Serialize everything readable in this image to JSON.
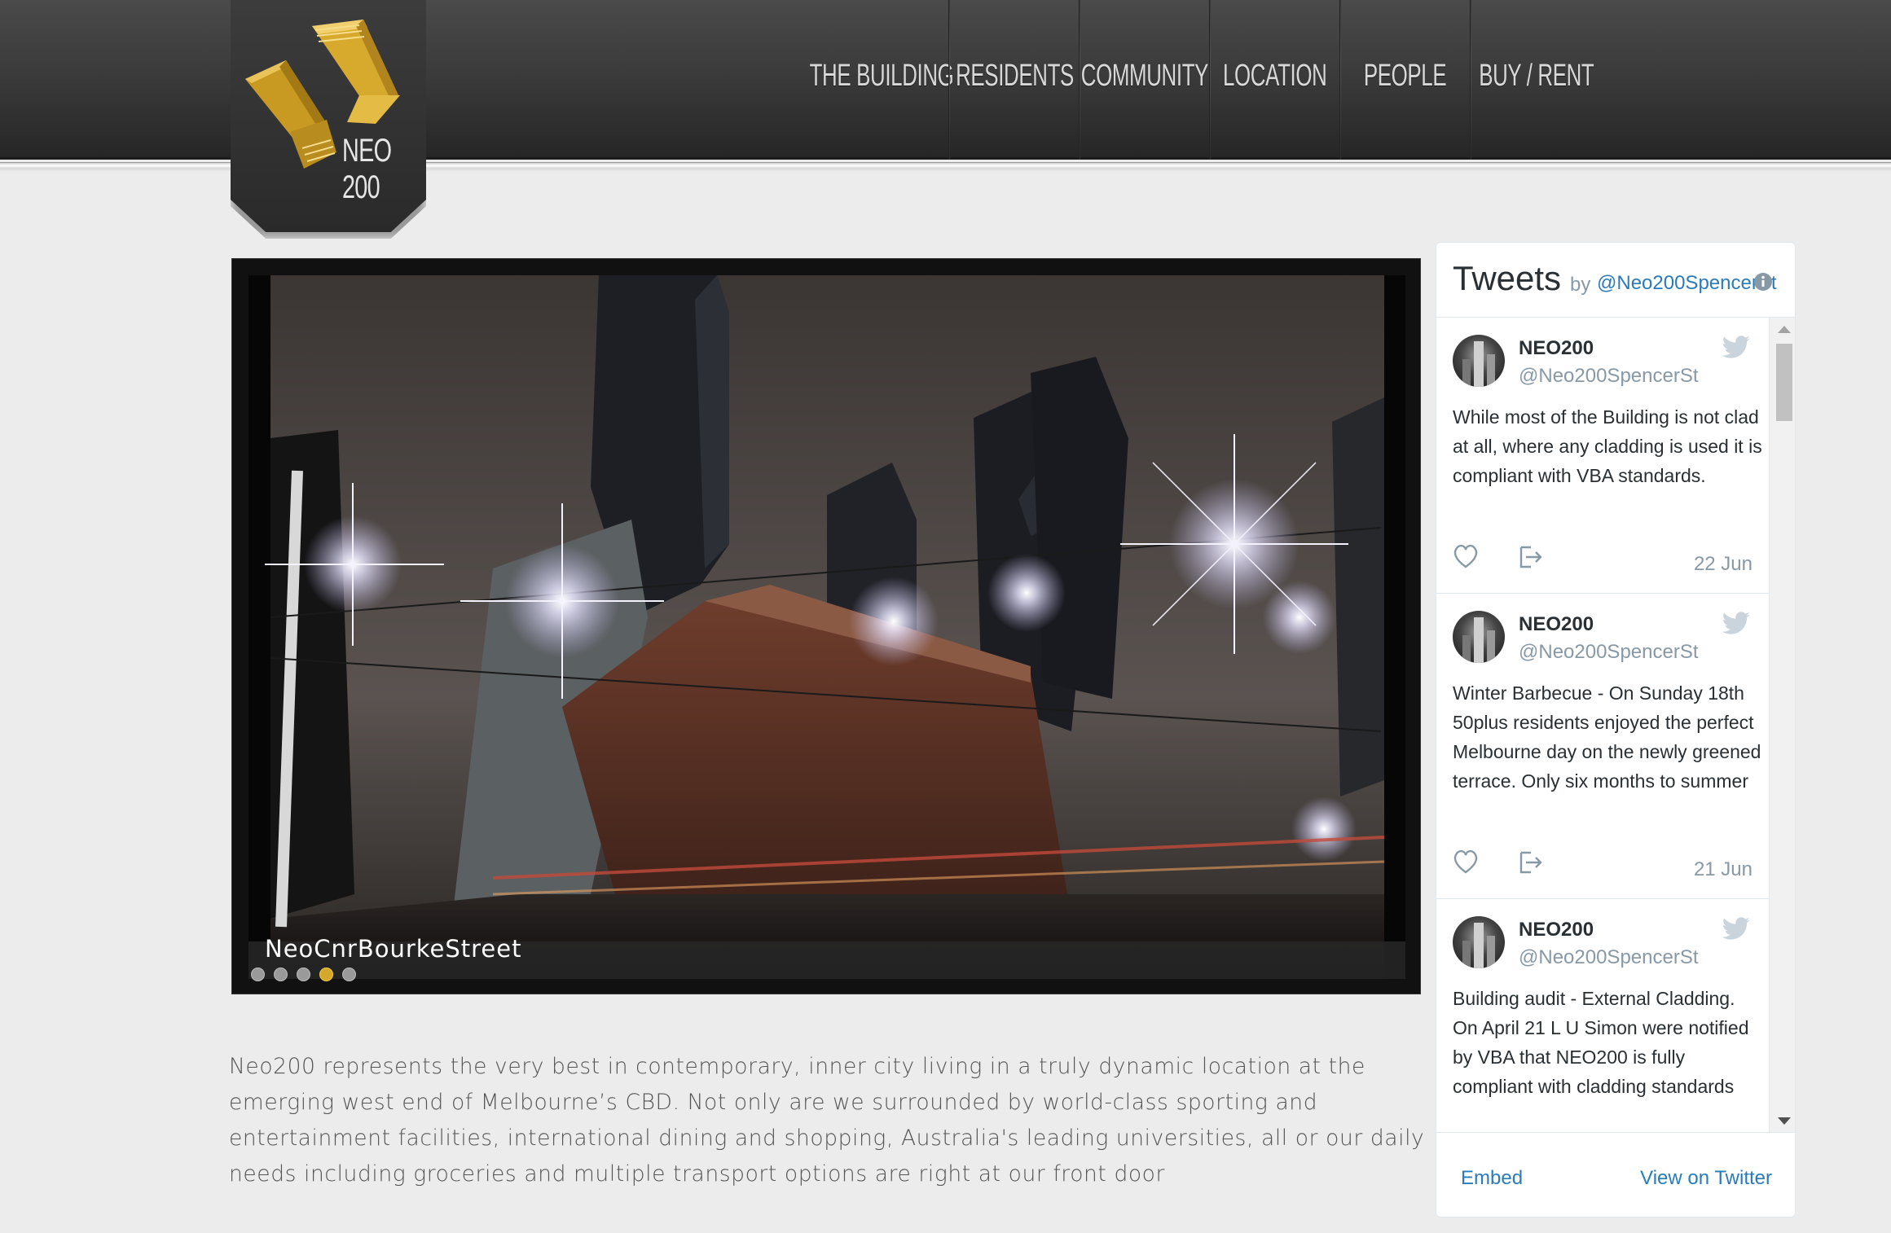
{
  "brand": {
    "logo_text": "NEO 200"
  },
  "nav": [
    {
      "label": "THE BUILDING"
    },
    {
      "label": "RESIDENTS"
    },
    {
      "label": "COMMUNITY"
    },
    {
      "label": "LOCATION"
    },
    {
      "label": "PEOPLE"
    },
    {
      "label": "BUY / RENT"
    }
  ],
  "slider": {
    "caption": "NeoCnrBourkeStreet",
    "dot_count": 5,
    "active_dot": 4
  },
  "intro": "Neo200 represents the very best in contemporary, inner city living in a truly dynamic location at the emerging west end of Melbourne’s CBD. Not only are we surrounded by world-class sporting and entertainment facilities, international dining and shopping, Australia's leading universities, all or our daily needs including groceries and multiple transport options are right at our front door",
  "twitter": {
    "title": "Tweets",
    "by": "by",
    "handle": "@Neo200SpencerSt",
    "tweets": [
      {
        "name": "NEO200",
        "user": "@Neo200SpencerSt",
        "text": "While most of the Building is not clad at all, where any cladding is used it is compliant with VBA standards.",
        "date": "22 Jun"
      },
      {
        "name": "NEO200",
        "user": "@Neo200SpencerSt",
        "text": "Winter Barbecue - On Sunday 18th 50plus residents enjoyed the perfect Melbourne day on the newly  greened terrace. Only six months to summer",
        "date": "21 Jun"
      },
      {
        "name": "NEO200",
        "user": "@Neo200SpencerSt",
        "text": "Building audit - External Cladding. On April 21 L U Simon were notified by VBA that NEO200 is fully compliant with cladding standards",
        "date": ""
      }
    ],
    "embed_label": "Embed",
    "view_label": "View on Twitter"
  },
  "colors": {
    "header": "#383838",
    "gold": "#d4a82a",
    "link": "#2b7bb9",
    "page_bg": "#ececec"
  }
}
